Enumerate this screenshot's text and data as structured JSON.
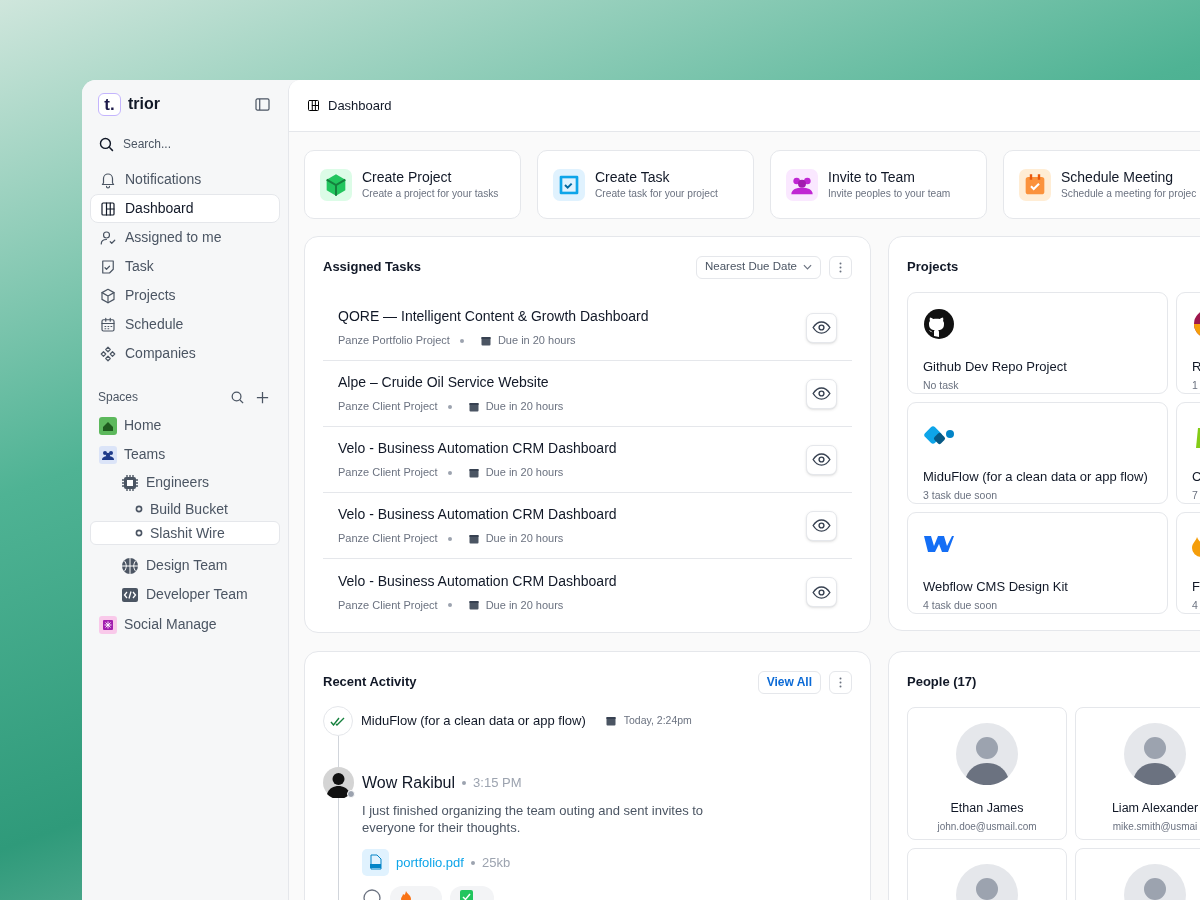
{
  "app": {
    "logo_mark": "t.",
    "name": "trior"
  },
  "sidebar": {
    "search_placeholder": "Search...",
    "nav": [
      {
        "label": "Notifications",
        "selected": false
      },
      {
        "label": "Dashboard",
        "selected": true
      },
      {
        "label": "Assigned to me",
        "selected": false
      },
      {
        "label": "Task",
        "selected": false
      },
      {
        "label": "Projects",
        "selected": false
      },
      {
        "label": "Schedule",
        "selected": false
      },
      {
        "label": "Companies",
        "selected": false
      }
    ],
    "spaces_label": "Spaces",
    "spaces": [
      {
        "label": "Home",
        "selected": false
      },
      {
        "label": "Teams",
        "selected": false,
        "children": [
          {
            "label": "Engineers",
            "selected": false,
            "children": [
              {
                "label": "Build Bucket",
                "selected": false
              },
              {
                "label": "Slashit Wire",
                "selected": true
              }
            ]
          },
          {
            "label": "Design Team",
            "selected": false
          },
          {
            "label": "Developer Team",
            "selected": false
          }
        ]
      },
      {
        "label": "Social Manage",
        "selected": false
      }
    ]
  },
  "header": {
    "title": "Dashboard"
  },
  "quick_actions": [
    {
      "title": "Create Project",
      "subtitle": "Create a project for your tasks"
    },
    {
      "title": "Create Task",
      "subtitle": "Create task for your project"
    },
    {
      "title": "Invite to Team",
      "subtitle": "Invite peoples to your team"
    },
    {
      "title": "Schedule Meeting",
      "subtitle": "Schedule a meeting for projec"
    }
  ],
  "assigned_tasks": {
    "title": "Assigned Tasks",
    "sort": "Nearest Due Date",
    "tasks": [
      {
        "title": "QORE — Intelligent Content & Growth Dashboard",
        "project": "Panze Portfolio Project",
        "due": "Due in 20 hours"
      },
      {
        "title": "Alpe – Cruide Oil Service Website",
        "project": "Panze Client Project",
        "due": "Due in 20 hours"
      },
      {
        "title": "Velo - Business Automation CRM Dashboard",
        "project": "Panze Client Project",
        "due": "Due in 20 hours"
      },
      {
        "title": "Velo - Business Automation CRM Dashboard",
        "project": "Panze Client Project",
        "due": "Due in 20 hours"
      },
      {
        "title": "Velo - Business Automation CRM Dashboard",
        "project": "Panze Client Project",
        "due": "Due in 20 hours"
      }
    ]
  },
  "projects": {
    "title": "Projects",
    "items": [
      {
        "name": "Github Dev Repo Project",
        "meta": "No task"
      },
      {
        "name": "R",
        "meta": "1"
      },
      {
        "name": "MiduFlow (for a clean data or app flow)",
        "meta": "3 task due soon"
      },
      {
        "name": "C",
        "meta": "7"
      },
      {
        "name": "Webflow CMS Design Kit",
        "meta": "4 task due soon"
      },
      {
        "name": "F",
        "meta": "4"
      }
    ]
  },
  "recent_activity": {
    "title": "Recent Activity",
    "view_all": "View All",
    "event": {
      "title": "MiduFlow (for a clean data or app flow)",
      "time": "Today, 2:24pm"
    },
    "comment": {
      "author": "Wow Rakibul",
      "time": "3:15 PM",
      "text": "I just finished organizing the team outing and sent invites to everyone for their thoughts.",
      "attachment": {
        "name": "portfolio.pdf",
        "size": "25kb"
      }
    }
  },
  "people": {
    "title": "People (17)",
    "items": [
      {
        "kind": "full",
        "name": "Ethan James",
        "email": "john.doe@usmail.com"
      },
      {
        "kind": "full",
        "name": "Liam Alexander",
        "email": "mike.smith@usmai"
      },
      {
        "kind": "partial"
      },
      {
        "kind": "partial"
      }
    ]
  }
}
